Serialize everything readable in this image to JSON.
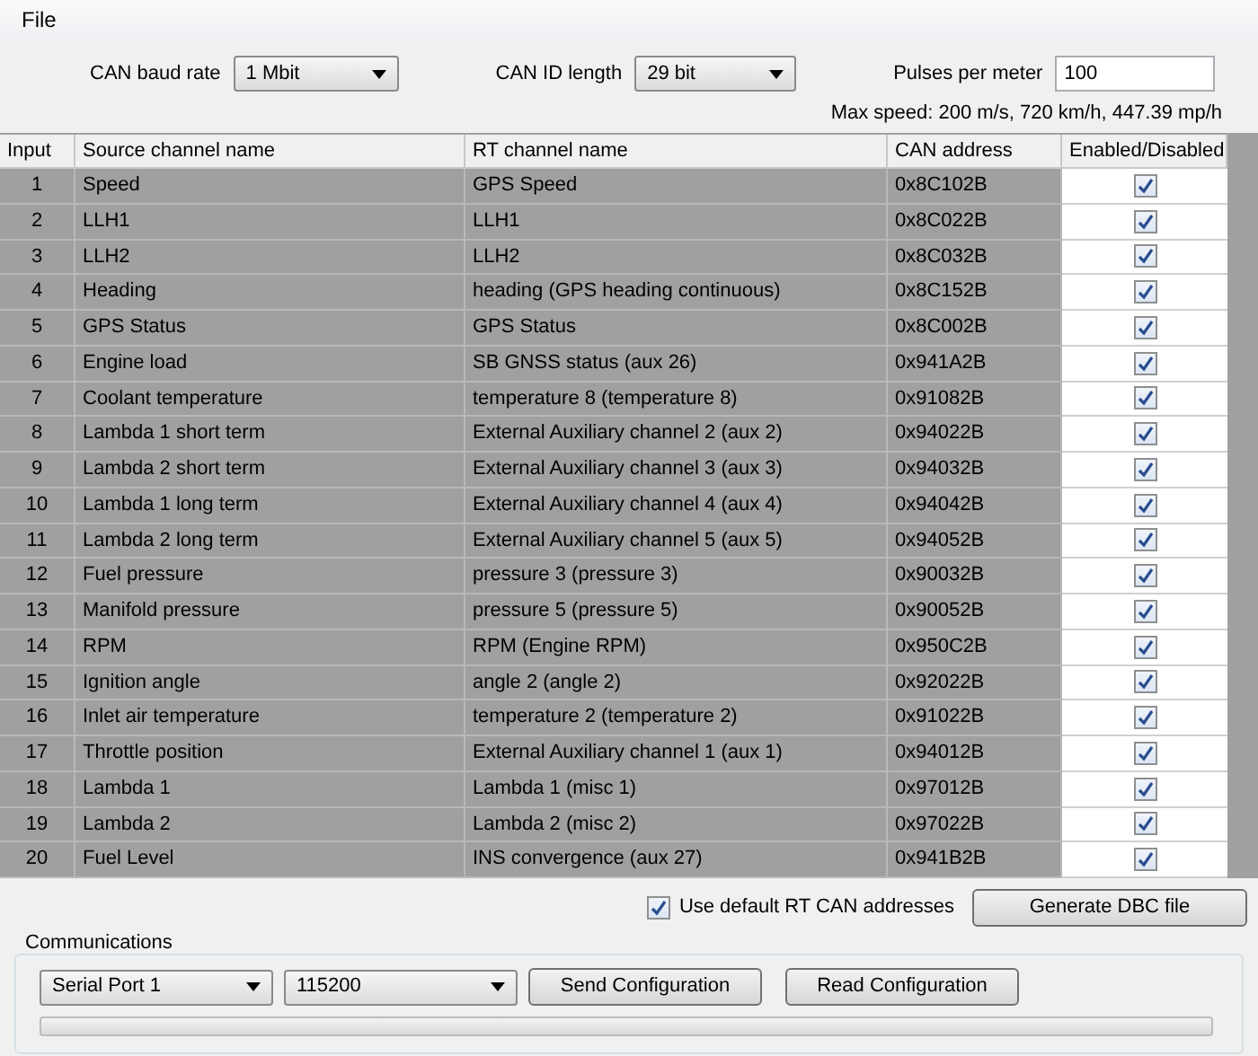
{
  "menu": [
    "File"
  ],
  "settings": {
    "baud_rate": {
      "label": "CAN baud rate",
      "value": "1 Mbit"
    },
    "id_length": {
      "label": "CAN ID length",
      "value": "29 bit"
    },
    "pulses": {
      "label": "Pulses per meter",
      "value": "100"
    },
    "max_speed": "Max speed: 200 m/s, 720 km/h, 447.39 mp/h"
  },
  "table": {
    "columns": [
      "Input",
      "Source channel name",
      "RT channel name",
      "CAN address",
      "Enabled/Disabled"
    ],
    "rows": [
      {
        "input": "1",
        "source": "Speed",
        "rt": "GPS Speed",
        "address": "0x8C102B",
        "enabled": true
      },
      {
        "input": "2",
        "source": "LLH1",
        "rt": "LLH1",
        "address": "0x8C022B",
        "enabled": true
      },
      {
        "input": "3",
        "source": "LLH2",
        "rt": "LLH2",
        "address": "0x8C032B",
        "enabled": true
      },
      {
        "input": "4",
        "source": "Heading",
        "rt": "heading (GPS heading continuous)",
        "address": "0x8C152B",
        "enabled": true
      },
      {
        "input": "5",
        "source": "GPS Status",
        "rt": "GPS Status",
        "address": "0x8C002B",
        "enabled": true
      },
      {
        "input": "6",
        "source": "Engine load",
        "rt": "SB GNSS status (aux 26)",
        "address": "0x941A2B",
        "enabled": true
      },
      {
        "input": "7",
        "source": "Coolant temperature",
        "rt": "temperature 8 (temperature 8)",
        "address": "0x91082B",
        "enabled": true
      },
      {
        "input": "8",
        "source": "Lambda 1 short term",
        "rt": "External Auxiliary channel 2 (aux 2)",
        "address": "0x94022B",
        "enabled": true
      },
      {
        "input": "9",
        "source": "Lambda 2 short term",
        "rt": "External Auxiliary channel 3 (aux 3)",
        "address": "0x94032B",
        "enabled": true
      },
      {
        "input": "10",
        "source": "Lambda 1 long term",
        "rt": "External Auxiliary channel 4 (aux 4)",
        "address": "0x94042B",
        "enabled": true
      },
      {
        "input": "11",
        "source": "Lambda 2 long term",
        "rt": "External Auxiliary channel 5 (aux 5)",
        "address": "0x94052B",
        "enabled": true
      },
      {
        "input": "12",
        "source": "Fuel pressure",
        "rt": "pressure 3 (pressure 3)",
        "address": "0x90032B",
        "enabled": true
      },
      {
        "input": "13",
        "source": "Manifold pressure",
        "rt": "pressure 5 (pressure 5)",
        "address": "0x90052B",
        "enabled": true
      },
      {
        "input": "14",
        "source": "RPM",
        "rt": "RPM (Engine RPM)",
        "address": "0x950C2B",
        "enabled": true
      },
      {
        "input": "15",
        "source": "Ignition angle",
        "rt": "angle 2 (angle 2)",
        "address": "0x92022B",
        "enabled": true
      },
      {
        "input": "16",
        "source": "Inlet air temperature",
        "rt": "temperature 2 (temperature 2)",
        "address": "0x91022B",
        "enabled": true
      },
      {
        "input": "17",
        "source": "Throttle position",
        "rt": "External Auxiliary channel 1 (aux 1)",
        "address": "0x94012B",
        "enabled": true
      },
      {
        "input": "18",
        "source": "Lambda 1",
        "rt": "Lambda 1 (misc 1)",
        "address": "0x97012B",
        "enabled": true
      },
      {
        "input": "19",
        "source": "Lambda 2",
        "rt": "Lambda 2 (misc 2)",
        "address": "0x97022B",
        "enabled": true
      },
      {
        "input": "20",
        "source": "Fuel Level",
        "rt": "INS convergence (aux 27)",
        "address": "0x941B2B",
        "enabled": true
      }
    ]
  },
  "use_default": {
    "label": "Use default RT CAN addresses",
    "checked": true
  },
  "generate_button": "Generate DBC file",
  "communications": {
    "title": "Communications",
    "port": "Serial Port 1",
    "baud": "115200",
    "send_button": "Send Configuration",
    "read_button": "Read Configuration",
    "progress": {
      "level": 0
    }
  }
}
